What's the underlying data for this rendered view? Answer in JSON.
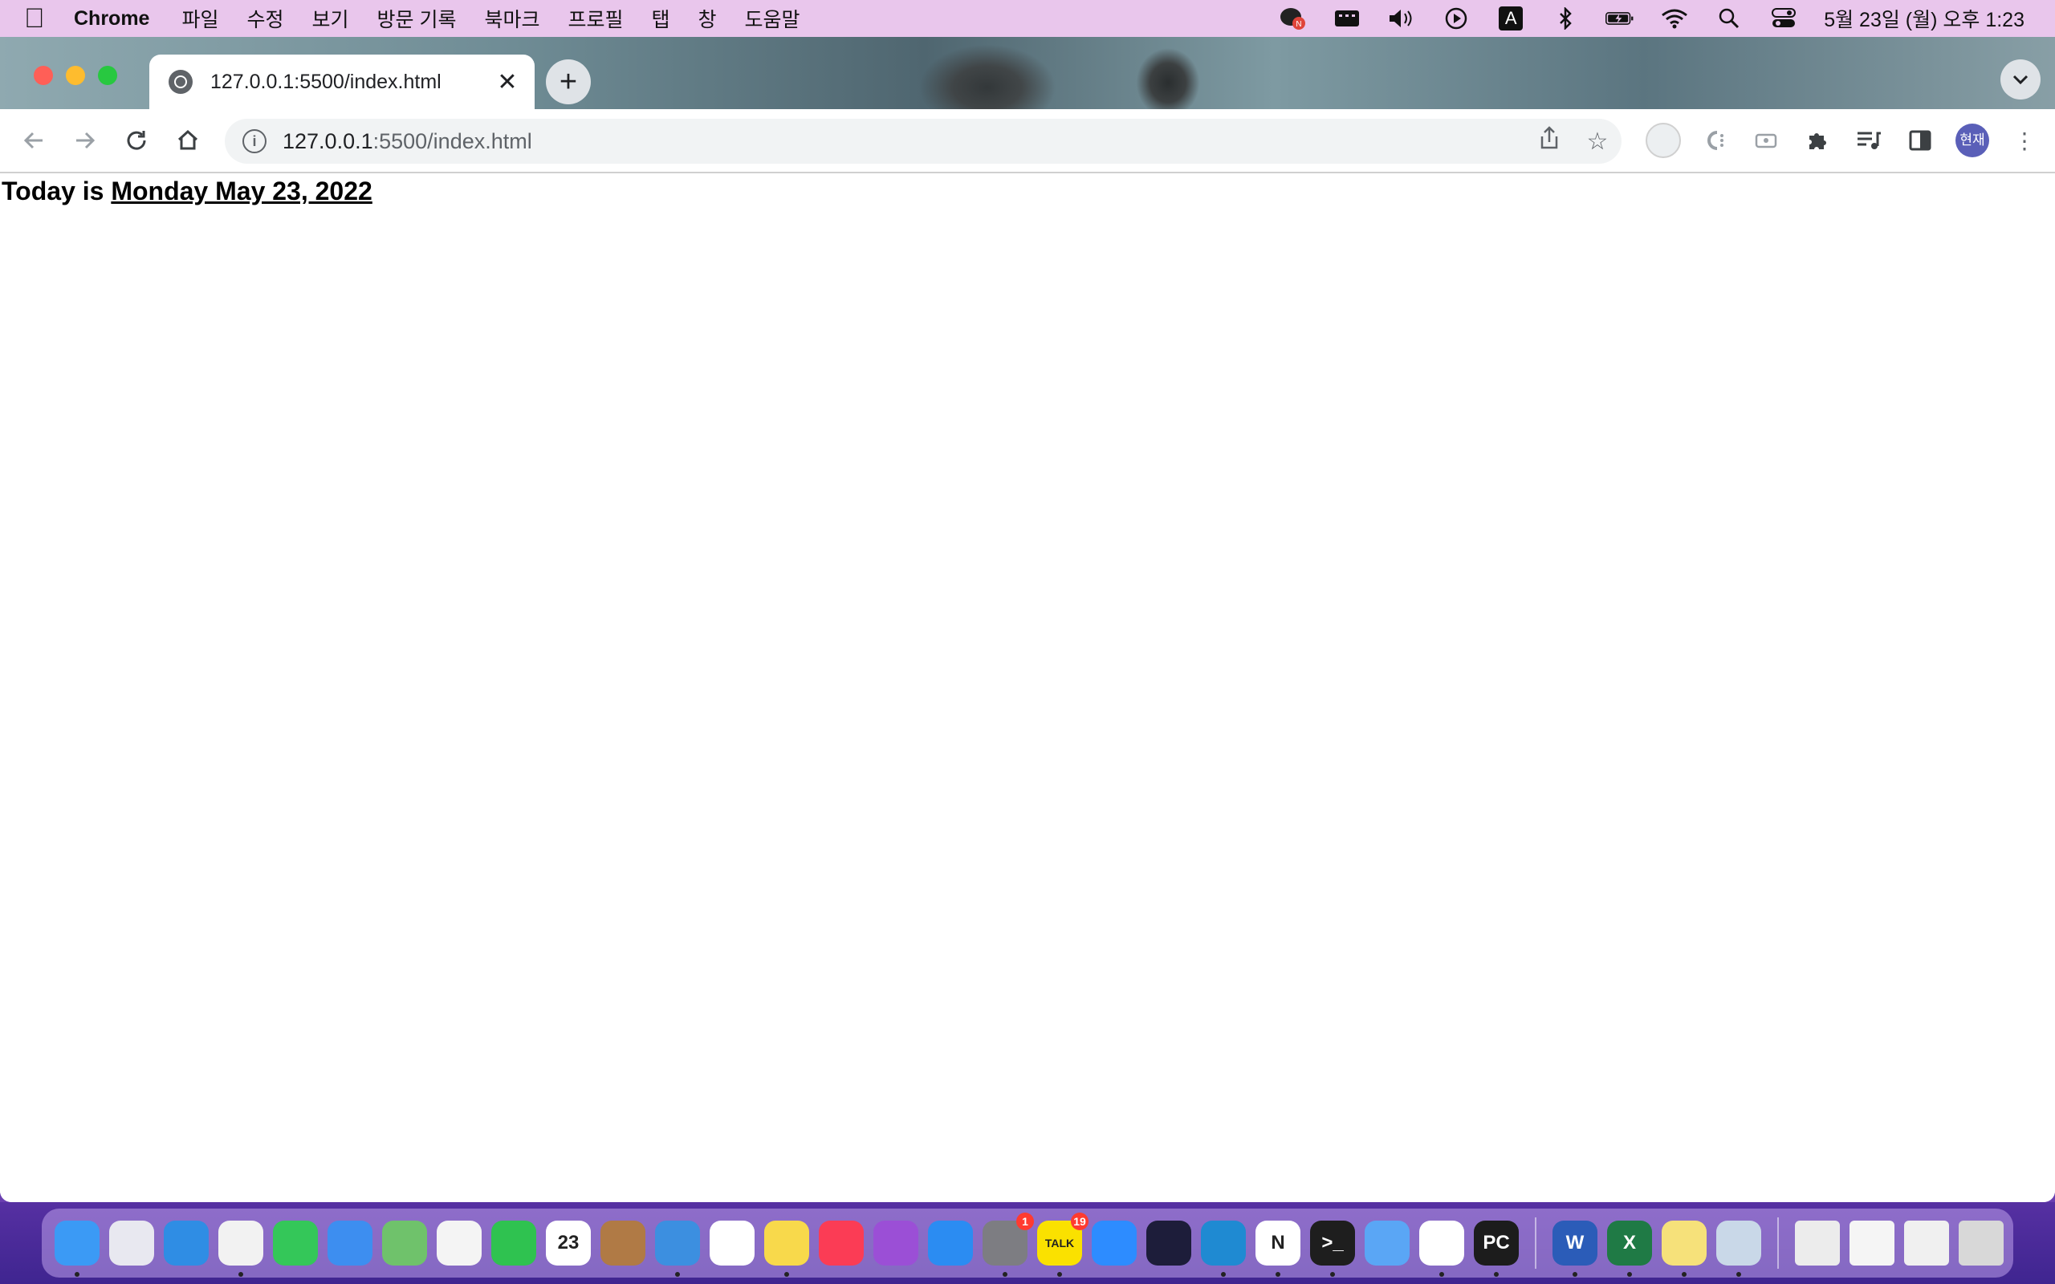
{
  "menubar": {
    "app_name": "Chrome",
    "items": [
      "파일",
      "수정",
      "보기",
      "방문 기록",
      "북마크",
      "프로필",
      "탭",
      "창",
      "도움말"
    ],
    "status_icons": [
      "messenger-icon",
      "display-icon",
      "volume-icon",
      "play-icon",
      "input-source-icon",
      "bluetooth-icon",
      "battery-icon",
      "wifi-icon",
      "spotlight-icon",
      "control-center-icon"
    ],
    "input_source": "A",
    "clock": "5월 23일 (월) 오후 1:23"
  },
  "browser": {
    "tab_title": "127.0.0.1:5500/index.html",
    "url_host": "127.0.0.1",
    "url_path": ":5500/index.html",
    "profile_initials": "현재"
  },
  "page": {
    "prefix": "Today is ",
    "date_link": "Monday May 23, 2022"
  },
  "dock": {
    "apps": [
      {
        "name": "finder",
        "color": "#3b9af5",
        "label": "",
        "running": true
      },
      {
        "name": "launchpad",
        "color": "#e8e8f0",
        "label": "",
        "running": false
      },
      {
        "name": "safari",
        "color": "#2f8de4",
        "label": "",
        "running": false
      },
      {
        "name": "chrome",
        "color": "#f2f2f2",
        "label": "",
        "running": true
      },
      {
        "name": "messages",
        "color": "#34c759",
        "label": "",
        "running": false
      },
      {
        "name": "mail",
        "color": "#3d8ef0",
        "label": "",
        "running": false
      },
      {
        "name": "maps",
        "color": "#6fc26b",
        "label": "",
        "running": false
      },
      {
        "name": "photos",
        "color": "#f4f4f4",
        "label": "",
        "running": false
      },
      {
        "name": "facetime",
        "color": "#2fc250",
        "label": "",
        "running": false
      },
      {
        "name": "calendar",
        "color": "#ffffff",
        "label": "23",
        "running": false
      },
      {
        "name": "contacts",
        "color": "#b07a45",
        "label": "",
        "running": false
      },
      {
        "name": "xcode",
        "color": "#3c8fe0",
        "label": "",
        "running": true
      },
      {
        "name": "reminders",
        "color": "#ffffff",
        "label": "",
        "running": false
      },
      {
        "name": "notes",
        "color": "#f8d94b",
        "label": "",
        "running": true
      },
      {
        "name": "music",
        "color": "#fb3c55",
        "label": "",
        "running": false
      },
      {
        "name": "podcasts",
        "color": "#9b4fd6",
        "label": "",
        "running": false
      },
      {
        "name": "app-store",
        "color": "#2b8cf2",
        "label": "",
        "running": false
      },
      {
        "name": "system-preferences",
        "color": "#7d7d82",
        "label": "",
        "badge": "1",
        "running": true
      },
      {
        "name": "kakaotalk",
        "color": "#fae100",
        "label": "TALK",
        "badge": "19",
        "running": true
      },
      {
        "name": "zoom",
        "color": "#2d8cff",
        "label": "",
        "running": false
      },
      {
        "name": "remote-app",
        "color": "#1d1d3a",
        "label": "",
        "running": false
      },
      {
        "name": "vscode",
        "color": "#1f8ad2",
        "label": "",
        "running": true
      },
      {
        "name": "notion",
        "color": "#ffffff",
        "label": "N",
        "running": true
      },
      {
        "name": "terminal",
        "color": "#1e1e1e",
        "label": ">_",
        "running": true
      },
      {
        "name": "simulator",
        "color": "#5aa6f5",
        "label": "",
        "running": false
      },
      {
        "name": "slack",
        "color": "#ffffff",
        "label": "",
        "running": true
      },
      {
        "name": "pycharm",
        "color": "#1c1c1c",
        "label": "PC",
        "running": true
      },
      {
        "name": "word",
        "color": "#2b5cb8",
        "label": "W",
        "running": true
      },
      {
        "name": "excel",
        "color": "#1f7a45",
        "label": "X",
        "running": true
      },
      {
        "name": "stickies",
        "color": "#f6e17a",
        "label": "",
        "running": true
      },
      {
        "name": "preview",
        "color": "#c9d8e8",
        "label": "",
        "running": true
      }
    ],
    "recent_docs": [
      {
        "name": "document-thumbnail",
        "color": "#ececec"
      },
      {
        "name": "chrome-window-thumbnail",
        "color": "#f5f5f5"
      },
      {
        "name": "chrome-window-thumbnail-2",
        "color": "#f0f0f0"
      },
      {
        "name": "trash",
        "color": "#d8d8d8"
      }
    ]
  }
}
